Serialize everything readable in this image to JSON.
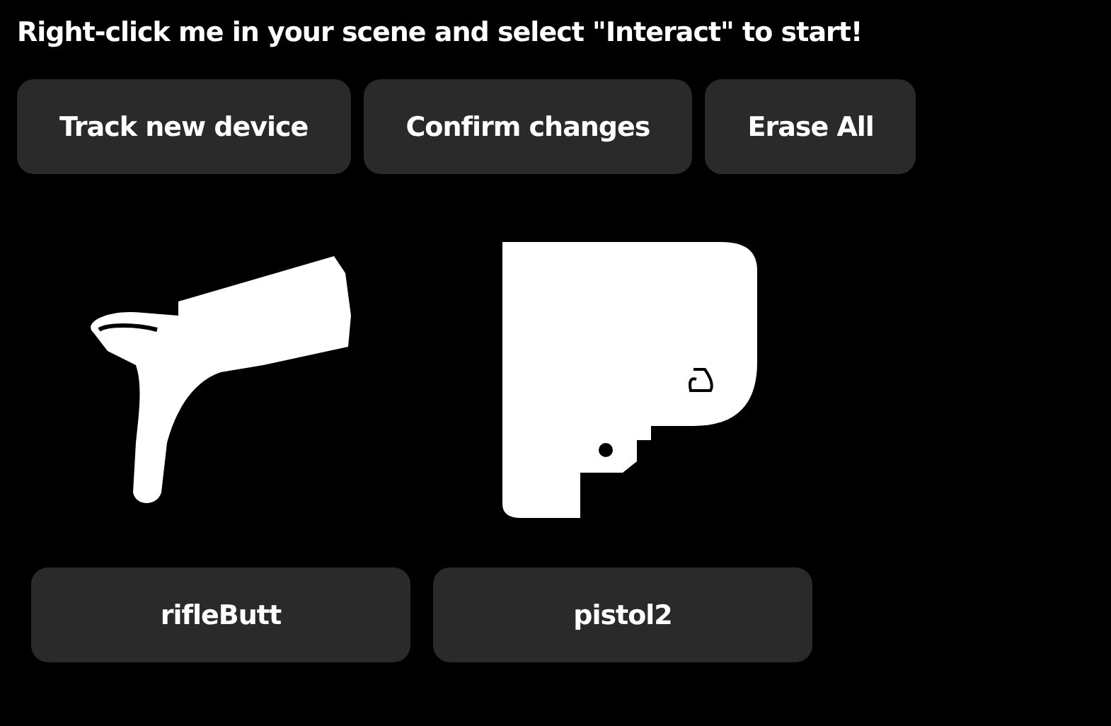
{
  "instruction": "Right-click me in your scene and select \"Interact\" to start!",
  "buttons": [
    "Track new device",
    "Confirm changes",
    "Erase All"
  ],
  "devices": [
    {
      "name": "rifleButt",
      "kind": "stock"
    },
    {
      "name": "pistol2",
      "kind": "grip"
    }
  ]
}
